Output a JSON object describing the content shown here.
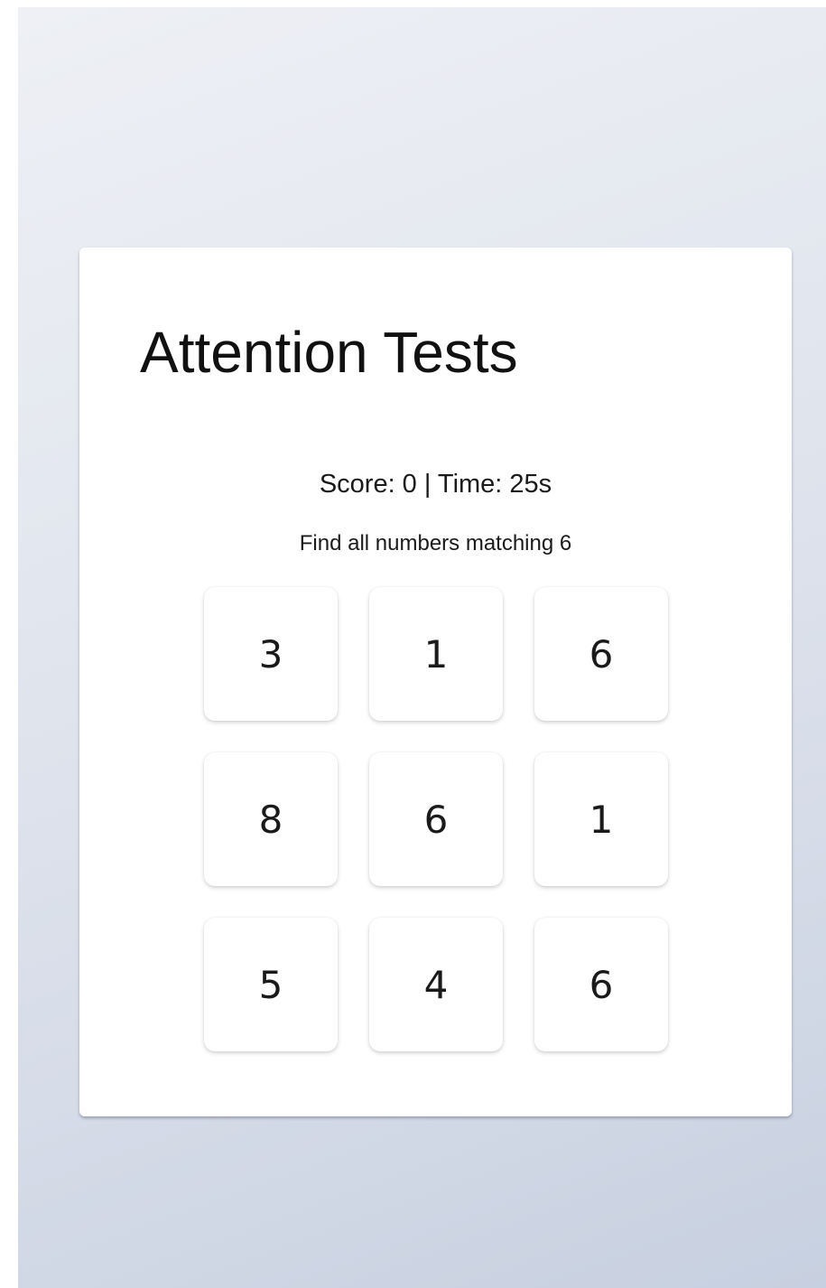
{
  "game": {
    "title": "Attention Tests",
    "status": "Score: 0 | Time: 25s",
    "instruction": "Find all numbers matching 6",
    "grid": [
      "3",
      "1",
      "6",
      "8",
      "6",
      "1",
      "5",
      "4",
      "6"
    ]
  }
}
